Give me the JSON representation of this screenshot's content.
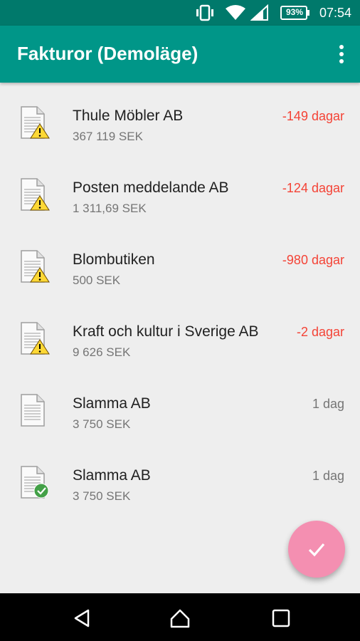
{
  "status_bar": {
    "battery": "93%",
    "time": "07:54",
    "icons": [
      "vibrate-icon",
      "wifi-icon",
      "signal-icon",
      "battery-icon"
    ]
  },
  "app_bar": {
    "title": "Fakturor (Demoläge)",
    "menu_icon": "more-vert-icon"
  },
  "invoices": [
    {
      "name": "Thule Möbler AB",
      "amount": "367 119 SEK",
      "due": "-149 dagar",
      "status": "warning"
    },
    {
      "name": "Posten meddelande AB",
      "amount": "1 311,69 SEK",
      "due": "-124 dagar",
      "status": "warning"
    },
    {
      "name": "Blombutiken",
      "amount": "500 SEK",
      "due": "-980 dagar",
      "status": "warning"
    },
    {
      "name": "Kraft och kultur i Sverige AB",
      "amount": "9 626 SEK",
      "due": "-2 dagar",
      "status": "warning"
    },
    {
      "name": "Slamma AB",
      "amount": "3 750 SEK",
      "due": "1 dag",
      "status": "none"
    },
    {
      "name": "Slamma AB",
      "amount": "3 750 SEK",
      "due": "1 dag",
      "status": "paid"
    }
  ],
  "fab": {
    "icon": "check-icon"
  },
  "colors": {
    "status_bar": "#00796b",
    "app_bar": "#009688",
    "overdue": "#f44336",
    "fab": "#f48fb1",
    "warning": "#fdd835",
    "paid": "#43a047"
  },
  "nav_bar": {
    "icons": [
      "back-icon",
      "home-icon",
      "recents-icon"
    ]
  }
}
